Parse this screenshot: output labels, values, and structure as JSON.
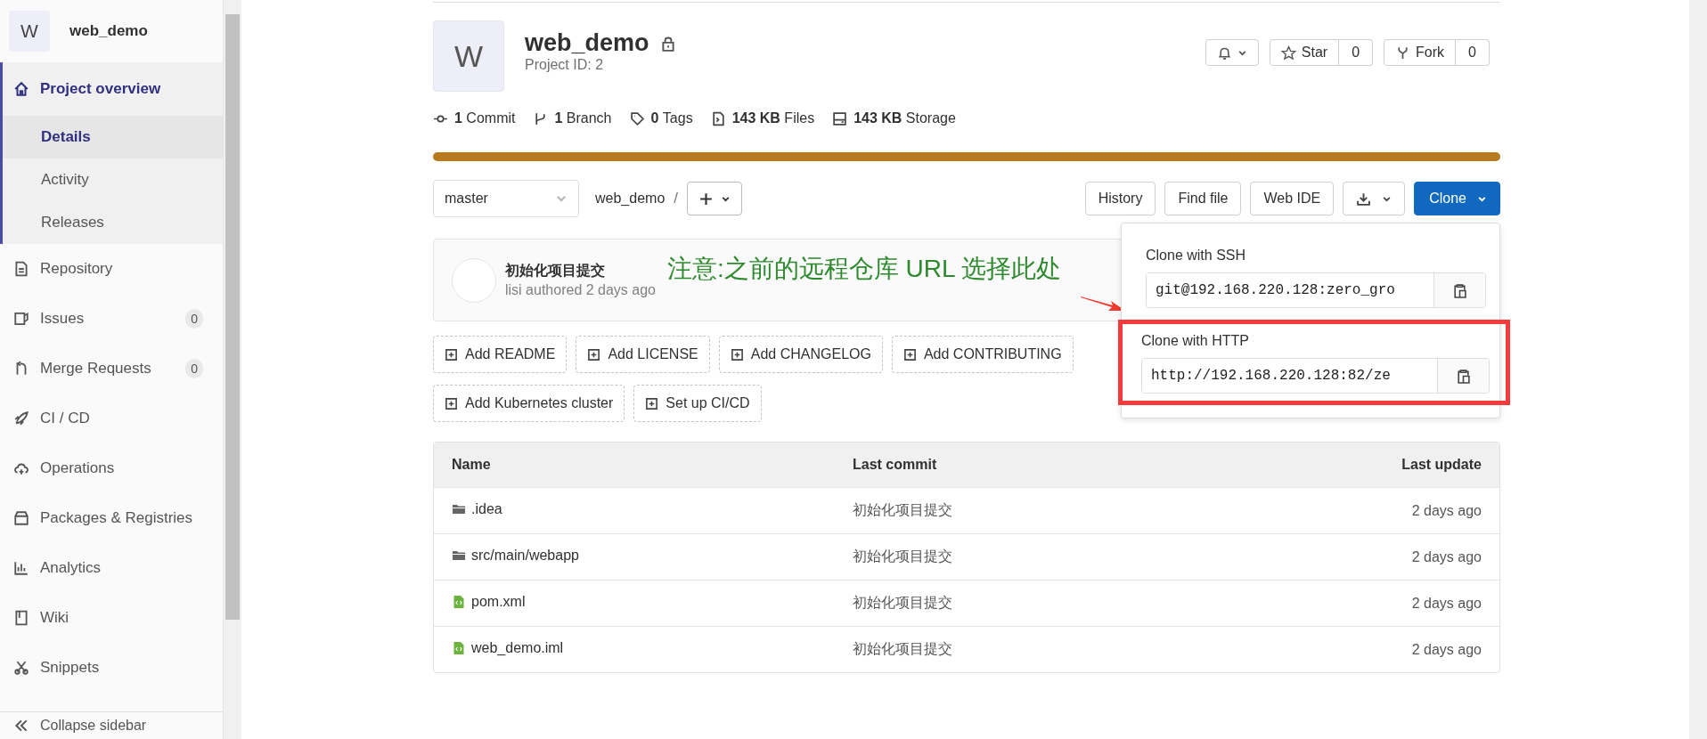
{
  "sidebar": {
    "project": {
      "avatar": "W",
      "name": "web_demo"
    },
    "items": [
      {
        "label": "Project overview",
        "selected": true,
        "children": [
          {
            "label": "Details",
            "selected": true
          },
          {
            "label": "Activity",
            "selected": false
          },
          {
            "label": "Releases",
            "selected": false
          }
        ]
      },
      {
        "label": "Repository",
        "selected": false
      },
      {
        "label": "Issues",
        "selected": false,
        "count": "0"
      },
      {
        "label": "Merge Requests",
        "selected": false,
        "count": "0"
      },
      {
        "label": "CI / CD",
        "selected": false
      },
      {
        "label": "Operations",
        "selected": false
      },
      {
        "label": "Packages & Registries",
        "selected": false
      },
      {
        "label": "Analytics",
        "selected": false
      },
      {
        "label": "Wiki",
        "selected": false
      },
      {
        "label": "Snippets",
        "selected": false
      }
    ],
    "collapse": "Collapse sidebar"
  },
  "header": {
    "avatar": "W",
    "title": "web_demo",
    "locked": true,
    "project_id": "Project ID: 2",
    "star": {
      "label": "Star",
      "count": "0"
    },
    "fork": {
      "label": "Fork",
      "count": "0"
    }
  },
  "stats": [
    {
      "value": "1",
      "label": "Commit"
    },
    {
      "value": "1",
      "label": "Branch"
    },
    {
      "value": "0",
      "label": "Tags"
    },
    {
      "value": "143 KB",
      "label": "Files"
    },
    {
      "value": "143 KB",
      "label": "Storage"
    }
  ],
  "toolbar": {
    "branch": "master",
    "path": "web_demo",
    "separator": "/",
    "buttons": [
      "History",
      "Find file",
      "Web IDE"
    ],
    "clone": "Clone"
  },
  "commit": {
    "title": "初始化项目提交",
    "meta": "lisi authored 2 days ago"
  },
  "annotation": "注意:之前的远程仓库 URL 选择此处",
  "add_buttons": [
    [
      "Add README",
      "Add LICENSE",
      "Add CHANGELOG",
      "Add CONTRIBUTING"
    ],
    [
      "Add Kubernetes cluster",
      "Set up CI/CD"
    ]
  ],
  "clone_menu": [
    {
      "label": "Clone with SSH",
      "value": "git@192.168.220.128:zero_gro",
      "highlighted": false
    },
    {
      "label": "Clone with HTTP",
      "value": "http://192.168.220.128:82/ze",
      "highlighted": true
    }
  ],
  "table": {
    "columns": [
      "Name",
      "Last commit",
      "Last update"
    ],
    "rows": [
      {
        "kind": "folder",
        "name": ".idea",
        "commit": "初始化项目提交",
        "updated": "2 days ago"
      },
      {
        "kind": "folder",
        "name": "src/main/webapp",
        "commit": "初始化项目提交",
        "updated": "2 days ago"
      },
      {
        "kind": "file",
        "name": "pom.xml",
        "commit": "初始化项目提交",
        "updated": "2 days ago"
      },
      {
        "kind": "file",
        "name": "web_demo.iml",
        "commit": "初始化项目提交",
        "updated": "2 days ago"
      }
    ]
  }
}
